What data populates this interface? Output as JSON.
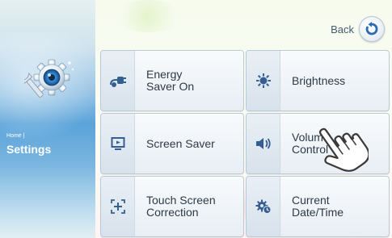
{
  "sidebar": {
    "breadcrumb_home": "Home |",
    "title": "Settings",
    "icon": "settings-gear-icon"
  },
  "header": {
    "back_label": "Back",
    "back_icon": "back-arrow-icon"
  },
  "menu": {
    "items": [
      {
        "label": "Energy\nSaver On",
        "icon": "energy-plug-icon"
      },
      {
        "label": "Brightness",
        "icon": "brightness-sun-icon"
      },
      {
        "label": "Screen Saver",
        "icon": "monitor-icon"
      },
      {
        "label": "Volume\nControl",
        "icon": "speaker-icon"
      },
      {
        "label": "Touch Screen\nCorrection",
        "icon": "crosshair-icon"
      },
      {
        "label": "Current\nDate/Time",
        "icon": "gear-clock-icon"
      }
    ]
  },
  "colors": {
    "accent_blue": "#2a69b4",
    "tile_text": "#2e3a46",
    "icon_blue": "#355f93"
  },
  "overlay": {
    "icon": "pointing-hand-icon"
  }
}
